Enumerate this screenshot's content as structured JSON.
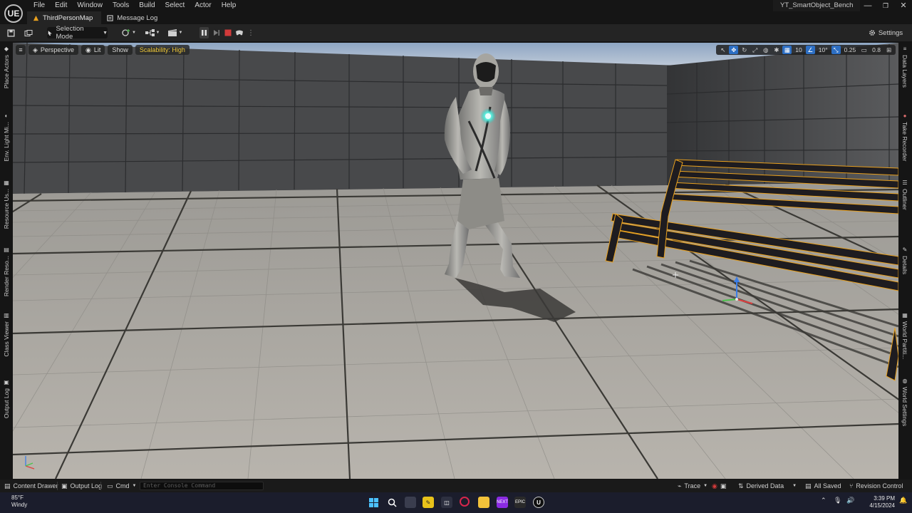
{
  "app": {
    "logo": "UE",
    "project": "YT_SmartObject_Bench",
    "menu": [
      "File",
      "Edit",
      "Window",
      "Tools",
      "Build",
      "Select",
      "Actor",
      "Help"
    ],
    "window_controls": [
      "—",
      "❐",
      "✕"
    ]
  },
  "tabs": [
    {
      "label": "ThirdPersonMap",
      "icon": "level-icon"
    },
    {
      "label": "Message Log",
      "icon": "message-log-icon"
    }
  ],
  "toolbar": {
    "selection_mode": "Selection Mode",
    "settings": "Settings"
  },
  "viewport": {
    "perspective": "Perspective",
    "lit": "Lit",
    "show": "Show",
    "scalability": "Scalability: High",
    "grid_snap": "10",
    "rotation_snap": "10°",
    "scale_snap": "0.25",
    "camera_speed": "0.8"
  },
  "left_panel": [
    "Place Actors",
    "Env. Light Mi...",
    "Resource Us...",
    "Render Reso...",
    "Class Viewer",
    "Output Log"
  ],
  "right_panel": [
    "Data Layers",
    "Take Recorder",
    "Outliner",
    "Details",
    "World Partiti...",
    "World Settings"
  ],
  "statusbar": {
    "content_drawer": "Content Drawer",
    "output_log": "Output Log",
    "cmd": "Cmd",
    "console_placeholder": "Enter Console Command",
    "trace": "Trace",
    "derived_data": "Derived Data",
    "all_saved": "All Saved",
    "revision_control": "Revision Control"
  },
  "taskbar": {
    "temperature": "85°F",
    "weather": "Windy",
    "time": "3:39 PM",
    "date": "4/15/2024"
  },
  "colors": {
    "accent_blue": "#2d6fc4",
    "scalability_yellow": "#f0c93a",
    "selection_orange": "#e8a01e",
    "stop_red": "#d23a3a"
  }
}
